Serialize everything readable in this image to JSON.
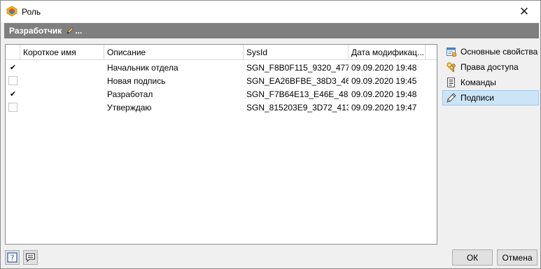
{
  "window": {
    "title": "Роль",
    "close_glyph": "✕"
  },
  "header": {
    "title": "Разработчик",
    "suffix": "..."
  },
  "grid": {
    "columns": [
      "",
      "Короткое имя",
      "Описание",
      "SysId",
      "Дата модификац..."
    ],
    "rows": [
      {
        "checked": true,
        "check_glyph": "✔",
        "short_name": "",
        "description": "Начальник отдела",
        "sysid": "SGN_F8B0F115_9320_4775...",
        "modified": "09.09.2020 19:48"
      },
      {
        "checked": false,
        "check_glyph": "",
        "short_name": "",
        "description": "Новая подпись",
        "sysid": "SGN_EA26BFBE_38D3_46...",
        "modified": "09.09.2020 19:45"
      },
      {
        "checked": true,
        "check_glyph": "✔",
        "short_name": "",
        "description": "Разработал",
        "sysid": "SGN_F7B64E13_E46E_487...",
        "modified": "09.09.2020 19:48"
      },
      {
        "checked": false,
        "check_glyph": "",
        "short_name": "",
        "description": "Утверждаю",
        "sysid": "SGN_815203E9_3D72_413...",
        "modified": "09.09.2020 19:47"
      }
    ]
  },
  "nav": {
    "items": [
      {
        "label": "Основные свойства",
        "icon": "properties-icon",
        "active": false
      },
      {
        "label": "Права доступа",
        "icon": "keys-icon",
        "active": false
      },
      {
        "label": "Команды",
        "icon": "commands-icon",
        "active": false
      },
      {
        "label": "Подписи",
        "icon": "signature-pen-icon",
        "active": true
      }
    ]
  },
  "footer": {
    "help_glyph": "?",
    "ok_label": "ОК",
    "cancel_label": "Отмена"
  }
}
